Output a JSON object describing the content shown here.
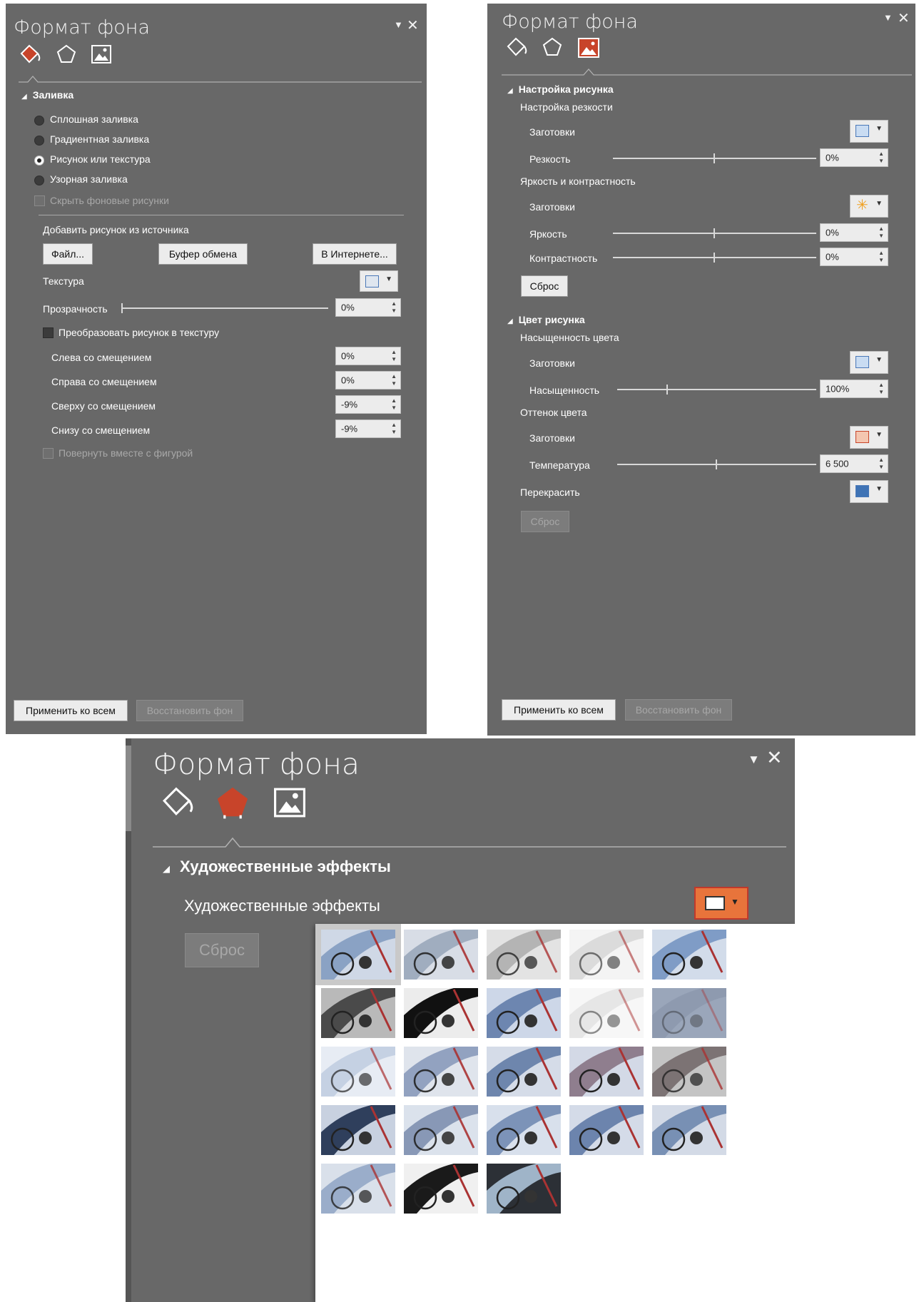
{
  "panels": {
    "fill": {
      "title": "Формат фона",
      "fill_section": "Заливка",
      "radio_options": [
        {
          "label": "Сплошная заливка",
          "selected": false
        },
        {
          "label": "Градиентная заливка",
          "selected": false
        },
        {
          "label": "Рисунок или текстура",
          "selected": true
        },
        {
          "label": "Узорная заливка",
          "selected": false
        }
      ],
      "hide_bg_label": "Скрыть фоновые рисунки",
      "insert_from_label": "Добавить рисунок из источника",
      "file_btn": "Файл...",
      "clipboard_btn": "Буфер обмена",
      "online_btn": "В Интернете...",
      "texture_label": "Текстура",
      "transparency_label": "Прозрачность",
      "transparency_value": "0%",
      "tile_label": "Преобразовать рисунок в текстуру",
      "offsets": [
        {
          "label": "Слева со смещением",
          "value": "0%"
        },
        {
          "label": "Справа со смещением",
          "value": "0%"
        },
        {
          "label": "Сверху со смещением",
          "value": "-9%"
        },
        {
          "label": "Снизу со смещением",
          "value": "-9%"
        }
      ],
      "rotate_label": "Повернуть вместе с фигурой",
      "apply_all_btn": "Применить ко всем",
      "reset_bg_btn": "Восстановить фон"
    },
    "picture": {
      "title": "Формат фона",
      "correction_section": "Настройка рисунка",
      "sharpness_group": "Настройка резкости",
      "presets_label": "Заготовки",
      "sharpness_label": "Резкость",
      "sharpness_value": "0%",
      "brightness_group": "Яркость и контрастность",
      "brightness_label": "Яркость",
      "brightness_value": "0%",
      "contrast_label": "Контрастность",
      "contrast_value": "0%",
      "reset_btn": "Сброс",
      "color_section": "Цвет рисунка",
      "saturation_group": "Насыщенность цвета",
      "saturation_label": "Насыщенность",
      "saturation_value": "100%",
      "tone_group": "Оттенок цвета",
      "temperature_label": "Температура",
      "temperature_value": "6 500",
      "recolor_label": "Перекрасить",
      "apply_all_btn": "Применить ко всем",
      "reset_bg_btn": "Восстановить фон"
    },
    "effects": {
      "title": "Формат фона",
      "section": "Художественные эффекты",
      "effects_label": "Художественные эффекты",
      "reset_btn": "Сброс",
      "gallery_count": 23
    }
  },
  "colors": {
    "panel_bg": "#686868",
    "accent_red": "#c8442a",
    "dropdown_highlight": "#e8743b"
  }
}
